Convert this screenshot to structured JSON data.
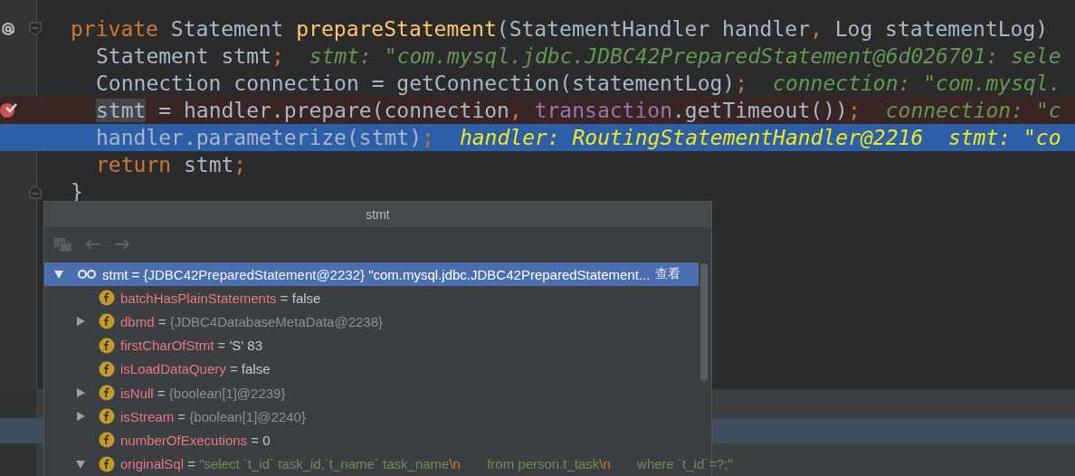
{
  "editor": {
    "lines": [
      {
        "kind": "declaration",
        "breakpoint": false,
        "current": false,
        "tokens": [
          {
            "kind": "keyword",
            "text": "private "
          },
          {
            "kind": "plain",
            "text": "Statement "
          },
          {
            "kind": "method",
            "text": "prepareStatement"
          },
          {
            "kind": "plain",
            "text": "(StatementHandler handler"
          },
          {
            "kind": "punct",
            "text": ", "
          },
          {
            "kind": "plain",
            "text": "Log statementLog) "
          }
        ],
        "children": [
          {
            "breakpoint": false,
            "current": false,
            "tokens": [
              {
                "kind": "plain",
                "text": "Statement stmt"
              },
              {
                "kind": "punct",
                "text": ";"
              }
            ],
            "hint": "stmt: \"com.mysql.jdbc.JDBC42PreparedStatement@6d026701: sele"
          },
          {
            "breakpoint": false,
            "current": false,
            "tokens": [
              {
                "kind": "plain",
                "text": "Connection connection = getConnection(statementLog)"
              },
              {
                "kind": "punct",
                "text": ";"
              }
            ],
            "hint": "connection: \"com.mysql."
          },
          {
            "breakpoint": true,
            "current": false,
            "tokens": [
              {
                "kind": "usage",
                "text": "stmt"
              },
              {
                "kind": "plain",
                "text": " = handler.prepare(connection"
              },
              {
                "kind": "punct",
                "text": ", "
              },
              {
                "kind": "field",
                "text": "transaction"
              },
              {
                "kind": "plain",
                "text": ".getTimeout())"
              },
              {
                "kind": "punct",
                "text": ";"
              }
            ],
            "hint": "connection: \"c"
          },
          {
            "breakpoint": false,
            "current": true,
            "tokens": [
              {
                "kind": "plain",
                "text": "handler.parameterize(stmt)"
              },
              {
                "kind": "punct",
                "text": ";"
              }
            ],
            "hint": "handler: RoutingStatementHandler@2216  stmt: \"co"
          },
          {
            "breakpoint": false,
            "current": false,
            "tokens": [
              {
                "kind": "keyword",
                "text": "return "
              },
              {
                "kind": "plain",
                "text": "stmt"
              },
              {
                "kind": "punct",
                "text": ";"
              }
            ]
          }
        ]
      },
      {
        "kind": "closing",
        "breakpoint": false,
        "current": false,
        "tokens": [
          {
            "kind": "plain",
            "text": "}"
          }
        ]
      }
    ]
  },
  "popup": {
    "title": "stmt",
    "tree": [
      {
        "kind": "watch",
        "expanded": true,
        "selected": true,
        "name": "stmt",
        "sign": "=",
        "value": [
          {
            "kind": "ref",
            "text": "{JDBC42PreparedStatement@2232} "
          },
          {
            "kind": "string",
            "text": "\"com.mysql.jdbc.JDBC42PreparedStatement..."
          }
        ],
        "link": "查看",
        "children": [
          {
            "kind": "field",
            "selected": false,
            "name": "batchHasPlainStatements",
            "sign": "=",
            "value": [
              {
                "kind": "primitive",
                "text": "false"
              }
            ]
          },
          {
            "kind": "field",
            "expanded": false,
            "selected": false,
            "name": "dbmd",
            "sign": "=",
            "value": [
              {
                "kind": "ref",
                "text": "{JDBC4DatabaseMetaData@2238}"
              }
            ]
          },
          {
            "kind": "field",
            "selected": false,
            "name": "firstCharOfStmt",
            "sign": "=",
            "value": [
              {
                "kind": "primitive",
                "text": "'S' 83"
              }
            ]
          },
          {
            "kind": "field",
            "selected": false,
            "name": "isLoadDataQuery",
            "sign": "=",
            "value": [
              {
                "kind": "primitive",
                "text": "false"
              }
            ]
          },
          {
            "kind": "field",
            "expanded": false,
            "selected": false,
            "name": "isNull",
            "sign": "=",
            "value": [
              {
                "kind": "ref",
                "text": "{boolean[1]@2239}"
              }
            ]
          },
          {
            "kind": "field",
            "expanded": false,
            "selected": false,
            "name": "isStream",
            "sign": "=",
            "value": [
              {
                "kind": "ref",
                "text": "{boolean[1]@2240}"
              }
            ]
          },
          {
            "kind": "field",
            "selected": false,
            "name": "numberOfExecutions",
            "sign": "=",
            "value": [
              {
                "kind": "primitive",
                "text": "0"
              }
            ]
          },
          {
            "kind": "field",
            "expanded": true,
            "selected": false,
            "name": "originalSql",
            "sign": "=",
            "value": [
              {
                "kind": "string",
                "text": "\"select `t_id` task_id,`t_name` task_name"
              },
              {
                "kind": "escape",
                "text": "\\n"
              },
              {
                "kind": "string",
                "text": "       from person.t_task"
              },
              {
                "kind": "escape",
                "text": "\\n"
              },
              {
                "kind": "string",
                "text": "       where `t_id`=?;\""
              }
            ]
          }
        ]
      }
    ]
  }
}
